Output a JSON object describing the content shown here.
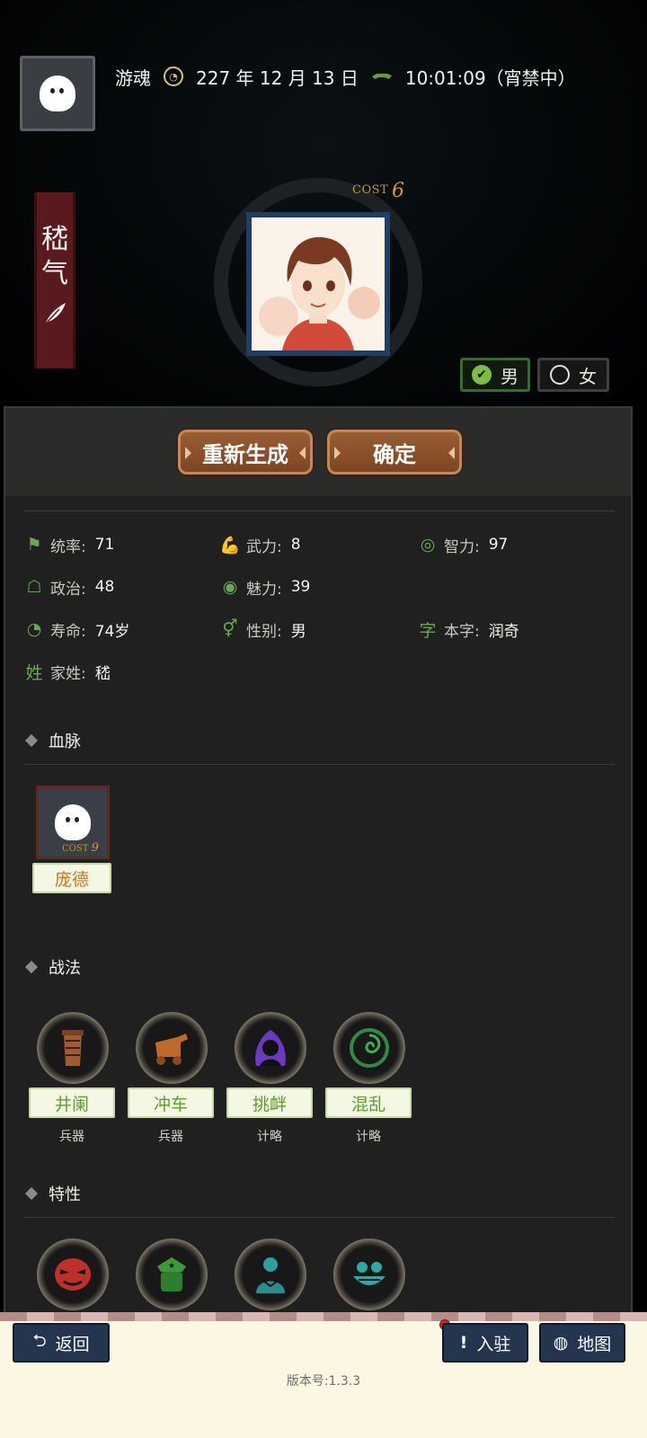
{
  "header": {
    "player_name": "游魂",
    "date": "227 年 12 月 13 日",
    "time": "10:01:09（宵禁中）"
  },
  "character": {
    "name_chars": [
      "嵇",
      "气"
    ],
    "cost_label": "COST",
    "cost_value": "6"
  },
  "gender_options": [
    {
      "label": "男",
      "selected": true
    },
    {
      "label": "女",
      "selected": false
    }
  ],
  "actions": {
    "regenerate": "重新生成",
    "confirm": "确定"
  },
  "stats": [
    {
      "label": "统率:",
      "value": "71",
      "icon": "flag-icon"
    },
    {
      "label": "武力:",
      "value": "8",
      "icon": "arm-icon"
    },
    {
      "label": "智力:",
      "value": "97",
      "icon": "brain-icon"
    },
    {
      "label": "政治:",
      "value": "48",
      "icon": "bag-icon"
    },
    {
      "label": "魅力:",
      "value": "39",
      "icon": "eye-icon"
    },
    {
      "label": "寿命:",
      "value": "74岁",
      "icon": "calendar-icon"
    },
    {
      "label": "性别:",
      "value": "男",
      "icon": "gender-icon"
    },
    {
      "label": "本字:",
      "value": "润奇",
      "icon": "zi-icon",
      "glyph": "字"
    },
    {
      "label": "家姓:",
      "value": "嵇",
      "icon": "xing-icon",
      "glyph": "姓"
    }
  ],
  "bloodline": {
    "title": "血脉",
    "cost_label": "COST",
    "cost_value": "9",
    "ancestor": "庞德"
  },
  "tactics": {
    "title": "战法",
    "items": [
      {
        "name": "井阑",
        "type": "兵器",
        "icon": "siege-tower-icon"
      },
      {
        "name": "冲车",
        "type": "兵器",
        "icon": "battering-ram-icon"
      },
      {
        "name": "挑衅",
        "type": "计略",
        "icon": "provoke-icon"
      },
      {
        "name": "混乱",
        "type": "计略",
        "icon": "confusion-icon"
      }
    ]
  },
  "traits": {
    "title": "特性",
    "items": [
      {
        "icon": "angry-mask-icon"
      },
      {
        "icon": "soldier-icon"
      },
      {
        "icon": "monk-icon"
      },
      {
        "icon": "grin-face-icon"
      }
    ]
  },
  "footer": {
    "back": "返回",
    "station": "入驻",
    "map": "地图",
    "version": "版本号:1.3.3"
  },
  "colors": {
    "accent_green": "#6aa84f",
    "button_brown": "#8a5230",
    "footer_button": "#24364f"
  }
}
